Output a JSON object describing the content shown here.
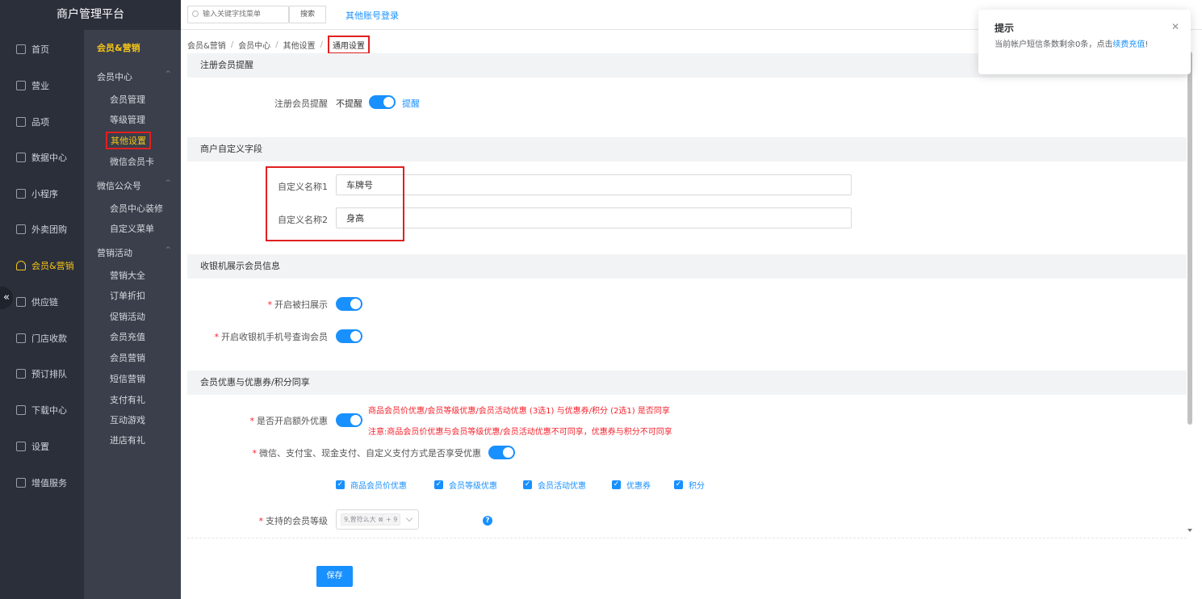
{
  "app": {
    "title": "商户管理平台"
  },
  "main_nav": {
    "items": [
      {
        "label": "首页"
      },
      {
        "label": "营业"
      },
      {
        "label": "品项"
      },
      {
        "label": "数据中心"
      },
      {
        "label": "小程序"
      },
      {
        "label": "外卖团购"
      },
      {
        "label": "会员&营销",
        "active": true
      },
      {
        "label": "供应链"
      },
      {
        "label": "门店收款"
      },
      {
        "label": "预订排队"
      },
      {
        "label": "下载中心"
      },
      {
        "label": "设置"
      },
      {
        "label": "增值服务"
      }
    ]
  },
  "sub_nav": {
    "title": "会员&营销",
    "groups": [
      {
        "label": "会员中心",
        "items": [
          "会员管理",
          "等级管理",
          "其他设置",
          "微信会员卡"
        ]
      },
      {
        "label": "微信公众号",
        "items": [
          "会员中心装修",
          "自定义菜单"
        ]
      },
      {
        "label": "营销活动",
        "items": [
          "营销大全",
          "订单折扣",
          "促销活动",
          "会员充值",
          "会员营销",
          "短信营销",
          "支付有礼",
          "互动游戏",
          "进店有礼"
        ]
      }
    ]
  },
  "top_bar": {
    "search_placeholder": "输入关键字找菜单",
    "search_button": "搜索",
    "other_login": "其他账号登录"
  },
  "breadcrumb": [
    "会员&营销",
    "会员中心",
    "其他设置",
    "通用设置"
  ],
  "sections": {
    "register_reminder": {
      "header": "注册会员提醒",
      "label": "注册会员提醒",
      "off_text": "不提醒",
      "on_text": "提醒",
      "enabled": true
    },
    "custom_fields": {
      "header": "商户自定义字段",
      "field1_label": "自定义名称1",
      "field1_value": "车牌号",
      "field2_label": "自定义名称2",
      "field2_value": "身高"
    },
    "cashier_display": {
      "header": "收银机展示会员信息",
      "scan_label": "开启被扫展示",
      "phone_label": "开启收银机手机号查询会员"
    },
    "discount_share": {
      "header": "会员优惠与优惠券/积分同享",
      "extra_label": "是否开启额外优惠",
      "warn1": "商品会员价优惠/会员等级优惠/会员活动优惠 (3选1) 与优惠券/积分 (2选1) 是否同享",
      "warn2": "注意:商品会员价优惠与会员等级优惠/会员活动优惠不可同享，优惠券与积分不可同享",
      "pay_label": "微信、支付宝、现金支付、自定义支付方式是否享受优惠",
      "checkboxes": [
        "商品会员价优惠",
        "会员等级优惠",
        "会员活动优惠",
        "优惠券",
        "积分"
      ],
      "level_label": "支持的会员等级",
      "level_tag1": "9,曾符么大",
      "level_tag2": "+ 9"
    }
  },
  "save_button": "保存",
  "toast": {
    "title": "提示",
    "message": "当前帐户短信条数剩余0条，点击",
    "link": "续费充值",
    "end": "!"
  }
}
